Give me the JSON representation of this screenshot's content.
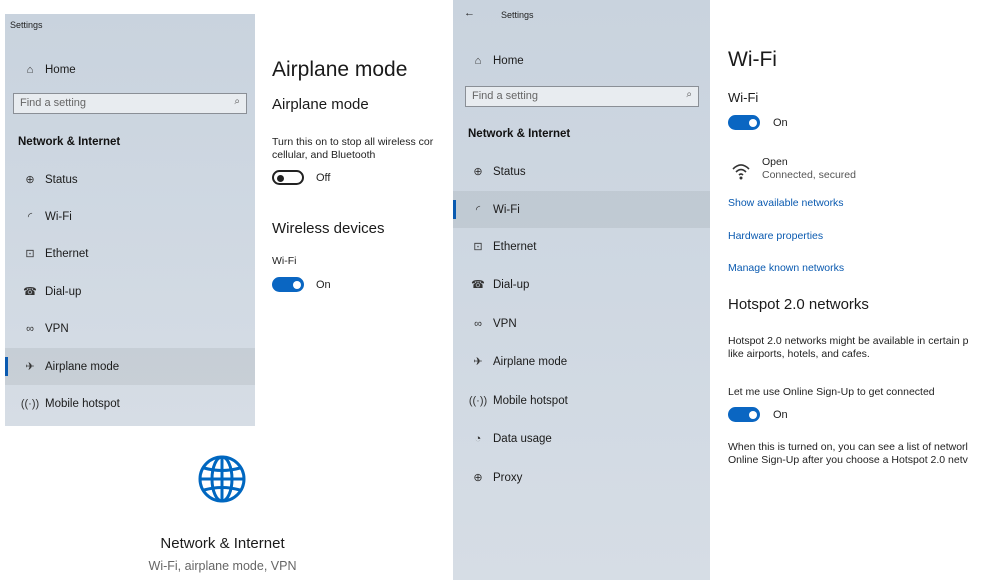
{
  "left_panel": {
    "window_title": "Settings",
    "home": "Home",
    "search_placeholder": "Find a setting",
    "section": "Network & Internet",
    "nav": [
      {
        "label": "Status",
        "icon": "globe-icon"
      },
      {
        "label": "Wi-Fi",
        "icon": "wifi-icon"
      },
      {
        "label": "Ethernet",
        "icon": "ethernet-icon"
      },
      {
        "label": "Dial-up",
        "icon": "dialup-icon"
      },
      {
        "label": "VPN",
        "icon": "vpn-icon"
      },
      {
        "label": "Airplane mode",
        "icon": "airplane-icon",
        "selected": true
      },
      {
        "label": "Mobile hotspot",
        "icon": "hotspot-icon"
      }
    ]
  },
  "airplane_page": {
    "title": "Airplane mode",
    "subtitle": "Airplane mode",
    "desc_line1": "Turn this on to stop all wireless cor",
    "desc_line2": "cellular, and Bluetooth",
    "airplane_toggle": "Off",
    "wireless_heading": "Wireless devices",
    "wifi_label": "Wi-Fi",
    "wifi_toggle": "On"
  },
  "network_tile": {
    "title": "Network & Internet",
    "subtitle": "Wi-Fi, airplane mode, VPN",
    "icon": "globe-icon"
  },
  "right_panel": {
    "back": "←",
    "window_title": "Settings",
    "home": "Home",
    "search_placeholder": "Find a setting",
    "section": "Network & Internet",
    "nav": [
      {
        "label": "Status",
        "icon": "globe-icon"
      },
      {
        "label": "Wi-Fi",
        "icon": "wifi-icon",
        "selected": true
      },
      {
        "label": "Ethernet",
        "icon": "ethernet-icon"
      },
      {
        "label": "Dial-up",
        "icon": "dialup-icon"
      },
      {
        "label": "VPN",
        "icon": "vpn-icon"
      },
      {
        "label": "Airplane mode",
        "icon": "airplane-icon"
      },
      {
        "label": "Mobile hotspot",
        "icon": "hotspot-icon"
      },
      {
        "label": "Data usage",
        "icon": "data-usage-icon"
      },
      {
        "label": "Proxy",
        "icon": "proxy-icon"
      }
    ]
  },
  "wifi_page": {
    "title": "Wi-Fi",
    "subtitle": "Wi-Fi",
    "wifi_toggle": "On",
    "network_name": "Open",
    "network_status": "Connected, secured",
    "links": [
      "Show available networks",
      "Hardware properties",
      "Manage known networks"
    ],
    "hotspot_heading": "Hotspot 2.0 networks",
    "hotspot_desc1": "Hotspot 2.0 networks might be available in certain p",
    "hotspot_desc2": "like airports, hotels, and cafes.",
    "signup_label": "Let me use Online Sign-Up to get connected",
    "signup_toggle": "On",
    "footer1": "When this is turned on, you can see a list of networl",
    "footer2": "Online Sign-Up after you choose a Hotspot 2.0 netv"
  },
  "colors": {
    "accent": "#0a66c2",
    "link": "#0a5ab0",
    "sidebar": "#cdd6e0"
  }
}
